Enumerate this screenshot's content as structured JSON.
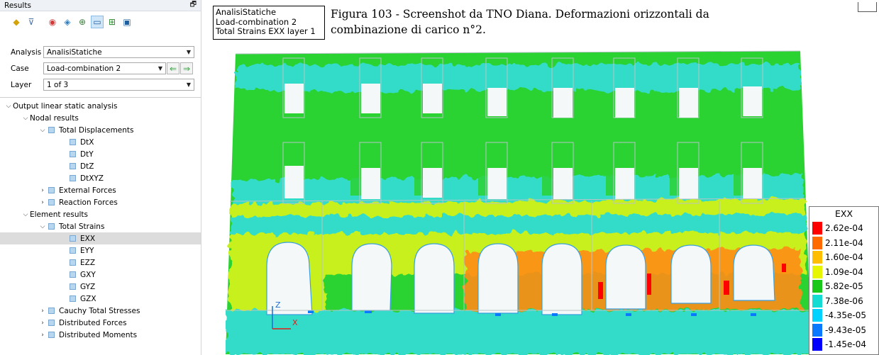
{
  "panel": {
    "title": "Results",
    "float_icon": "restore-window-icon",
    "toolbar": [
      {
        "icon": "results-colormap-icon"
      },
      {
        "icon": "filter-icon"
      },
      {
        "icon": "contour-plot-icon"
      },
      {
        "icon": "shaded-plot-icon"
      },
      {
        "icon": "mesh-plot-icon"
      },
      {
        "icon": "element-plot-icon"
      },
      {
        "icon": "grid-plot-icon"
      },
      {
        "icon": "frame-plot-icon"
      }
    ],
    "analysis": {
      "label": "Analysis",
      "value": "AnalisiStatiche"
    },
    "case": {
      "label": "Case",
      "value": "Load-combination 2"
    },
    "layer": {
      "label": "Layer",
      "value": "1 of 3"
    }
  },
  "tree": {
    "root": "Output linear static analysis",
    "nodal": "Nodal results",
    "total_displacements": "Total Displacements",
    "dtx": "DtX",
    "dty": "DtY",
    "dtz": "DtZ",
    "dtxyz": "DtXYZ",
    "external_forces": "External Forces",
    "reaction_forces": "Reaction Forces",
    "element": "Element results",
    "total_strains": "Total Strains",
    "exx": "EXX",
    "eyy": "EYY",
    "ezz": "EZZ",
    "gxy": "GXY",
    "gyz": "GYZ",
    "gzx": "GZX",
    "cauchy": "Cauchy Total Stresses",
    "distributed_forces": "Distributed Forces",
    "distributed_moments": "Distributed Moments"
  },
  "info_box": {
    "line1": "AnalisiStatiche",
    "line2": "Load-combination 2",
    "line3": "Total Strains EXX layer 1"
  },
  "caption": "Figura 103 - Screenshot da TNO Diana. Deformazioni orizzontali da combinazione di carico n°2.",
  "axes": {
    "z": "Z",
    "x": "X"
  },
  "legend": {
    "title": "EXX",
    "items": [
      {
        "value": "2.62e-04",
        "color": "#ff0000"
      },
      {
        "value": "2.11e-04",
        "color": "#ff6a00"
      },
      {
        "value": "1.60e-04",
        "color": "#ffbf00"
      },
      {
        "value": "1.09e-04",
        "color": "#e6f500"
      },
      {
        "value": "5.82e-05",
        "color": "#19c819"
      },
      {
        "value": "7.38e-06",
        "color": "#15dcd2"
      },
      {
        "value": "-4.35e-05",
        "color": "#00d2ff"
      },
      {
        "value": "-9.43e-05",
        "color": "#0a78ff"
      },
      {
        "value": "-1.45e-04",
        "color": "#0000ff"
      }
    ]
  },
  "colors": {
    "green_field": "#2ad232",
    "cyan_band": "#32dcc8",
    "yellow_band": "#c8f01e",
    "orange_zone": "#ff8c14",
    "opening_fill": "#f4f8f9"
  }
}
